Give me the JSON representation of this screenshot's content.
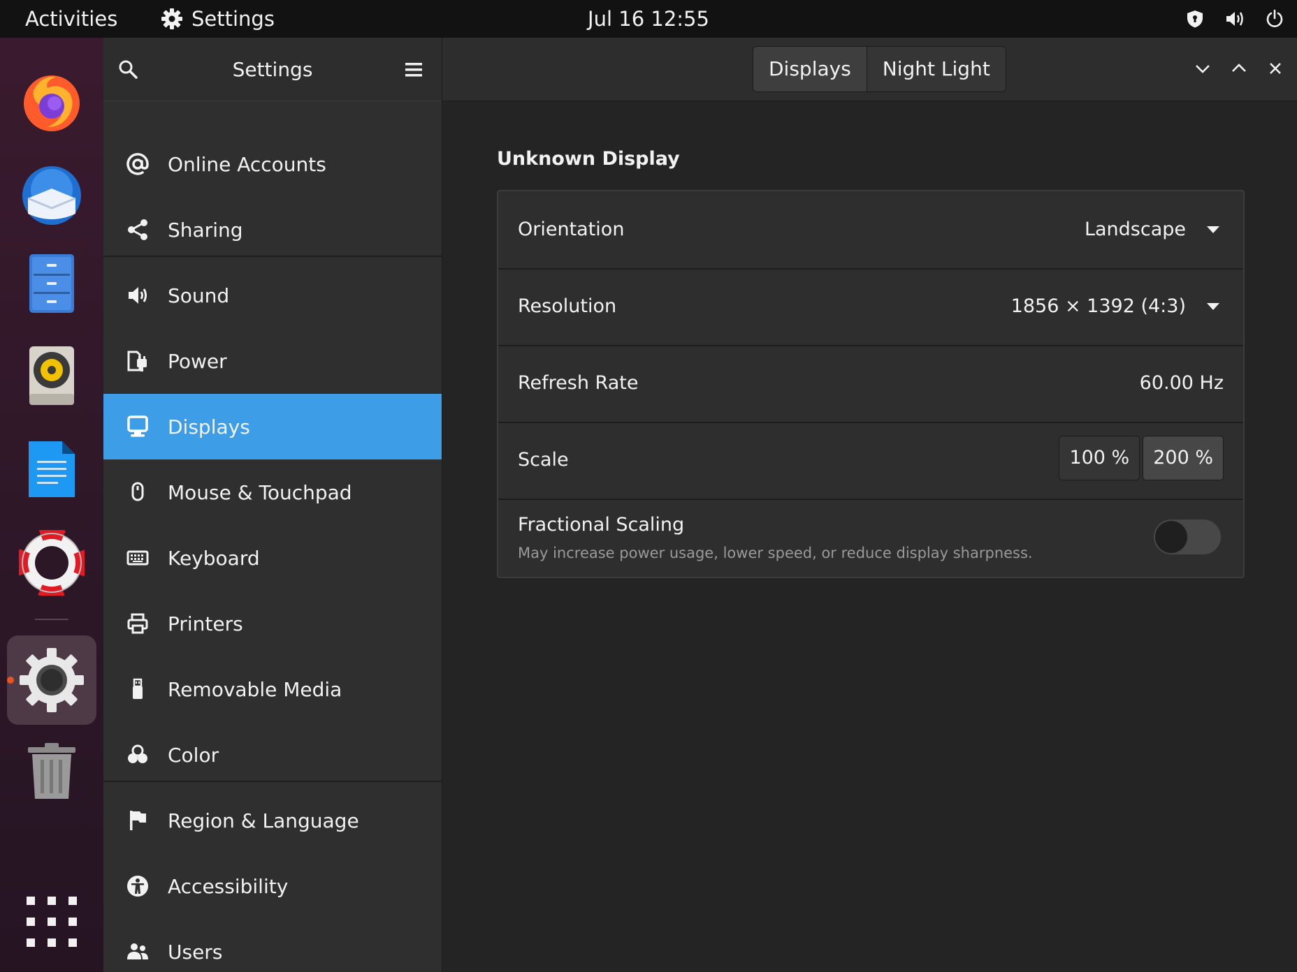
{
  "topbar": {
    "activities": "Activities",
    "app_name": "Settings",
    "clock": "Jul 16  12:55"
  },
  "dock": {
    "items": [
      "firefox-icon",
      "thunderbird-icon",
      "files-icon",
      "rhythmbox-icon",
      "writer-icon",
      "help-icon",
      "settings-icon",
      "trash-icon",
      "app-grid-icon"
    ],
    "active_item": "settings-icon"
  },
  "sidebar": {
    "title": "Settings",
    "items": [
      {
        "label": "Online Accounts",
        "icon": "at-icon"
      },
      {
        "label": "Sharing",
        "icon": "share-icon"
      },
      {
        "label": "Sound",
        "icon": "speaker-icon"
      },
      {
        "label": "Power",
        "icon": "power-plug-icon"
      },
      {
        "label": "Displays",
        "icon": "display-icon"
      },
      {
        "label": "Mouse & Touchpad",
        "icon": "mouse-icon"
      },
      {
        "label": "Keyboard",
        "icon": "keyboard-icon"
      },
      {
        "label": "Printers",
        "icon": "printer-icon"
      },
      {
        "label": "Removable Media",
        "icon": "usb-icon"
      },
      {
        "label": "Color",
        "icon": "color-icon"
      },
      {
        "label": "Region & Language",
        "icon": "flag-icon"
      },
      {
        "label": "Accessibility",
        "icon": "accessibility-icon"
      },
      {
        "label": "Users",
        "icon": "users-icon"
      }
    ],
    "selected": "Displays"
  },
  "main": {
    "tabs": [
      {
        "label": "Displays",
        "active": true
      },
      {
        "label": "Night Light",
        "active": false
      }
    ],
    "section_title": "Unknown Display",
    "rows": {
      "orientation": {
        "label": "Orientation",
        "value": "Landscape"
      },
      "resolution": {
        "label": "Resolution",
        "value": "1856 × 1392 (4:3)"
      },
      "refresh": {
        "label": "Refresh Rate",
        "value": "60.00 Hz"
      },
      "scale": {
        "label": "Scale",
        "options": [
          "100 %",
          "200 %"
        ],
        "selected": "200 %"
      },
      "fractional": {
        "label": "Fractional Scaling",
        "description": "May increase power usage, lower speed, or reduce display sharpness.",
        "enabled": false
      }
    }
  },
  "colors": {
    "accent": "#3d9ee7",
    "topbar": "#121212",
    "dock": "#2c1727",
    "running_dot": "#e95420"
  }
}
